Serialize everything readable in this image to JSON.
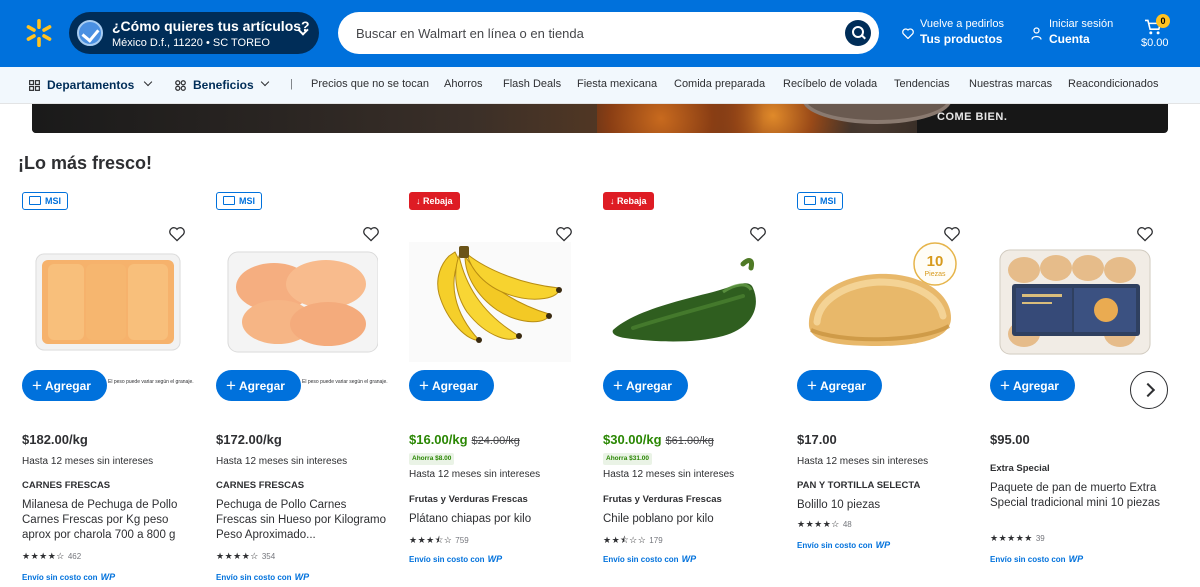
{
  "header": {
    "location_title": "¿Cómo quieres tus artículos?",
    "location_sub": "México D.f., 11220 • SC TOREO",
    "search_placeholder": "Buscar en Walmart en línea o en tienda",
    "reorder_small": "Vuelve a pedirlos",
    "reorder_big": "Tus productos",
    "signin_small": "Iniciar sesión",
    "signin_big": "Cuenta",
    "cart_count": "0",
    "cart_total": "$0.00"
  },
  "nav": {
    "departments": "Departamentos",
    "benefits": "Beneficios",
    "separator": "|",
    "links": [
      "Precios que no se tocan",
      "Ahorros",
      "Flash Deals",
      "Fiesta mexicana",
      "Comida preparada",
      "Recíbelo de volada",
      "Tendencias",
      "Nuestras marcas",
      "Reacondicionados"
    ]
  },
  "banner": {
    "tagline": "COME BIEN."
  },
  "section": {
    "title": "¡Lo más fresco!"
  },
  "products": [
    {
      "badge": "MSI",
      "badge_type": "msi",
      "add_label": "Agregar",
      "fine_print": "El peso puede variar según el granaje.",
      "price": "$182.00/kg",
      "was": "",
      "savings": "",
      "installments": "Hasta 12 meses sin intereses",
      "brand": "CARNES FRESCAS",
      "title": "Milanesa de Pechuga de Pollo Carnes Frescas por Kg peso aprox por charola 700 a 800 g",
      "stars": "★★★★☆",
      "rating_count": "462",
      "shipping": "Envío sin costo con",
      "wp": "WP"
    },
    {
      "badge": "MSI",
      "badge_type": "msi",
      "add_label": "Agregar",
      "fine_print": "El peso puede variar según el granaje.",
      "price": "$172.00/kg",
      "was": "",
      "savings": "",
      "installments": "Hasta 12 meses sin intereses",
      "brand": "CARNES FRESCAS",
      "title": "Pechuga de Pollo Carnes Frescas sin Hueso por Kilogramo Peso Aproximado...",
      "stars": "★★★★☆",
      "rating_count": "354",
      "shipping": "Envío sin costo con",
      "wp": "WP"
    },
    {
      "badge": "Rebaja",
      "badge_type": "sale",
      "add_label": "Agregar",
      "fine_print": "",
      "price": "$16.00/kg",
      "was": "$24.00/kg",
      "savings": "Ahorra $8.00",
      "installments": "Hasta 12 meses sin intereses",
      "brand": "Frutas y Verduras Frescas",
      "title": "Plátano chiapas por kilo",
      "stars": "★★★⯪☆",
      "rating_count": "759",
      "shipping": "Envío sin costo con",
      "wp": "WP"
    },
    {
      "badge": "Rebaja",
      "badge_type": "sale",
      "add_label": "Agregar",
      "fine_print": "",
      "price": "$30.00/kg",
      "was": "$61.00/kg",
      "savings": "Ahorra $31.00",
      "installments": "Hasta 12 meses sin intereses",
      "brand": "Frutas y Verduras Frescas",
      "title": "Chile poblano por kilo",
      "stars": "★★⯪☆☆",
      "rating_count": "179",
      "shipping": "Envío sin costo con",
      "wp": "WP"
    },
    {
      "badge": "MSI",
      "badge_type": "msi",
      "add_label": "Agregar",
      "fine_print": "",
      "price": "$17.00",
      "was": "",
      "savings": "",
      "installments": "Hasta 12 meses sin intereses",
      "brand": "PAN Y TORTILLA SELECTA",
      "title": "Bolillo 10 piezas",
      "stars": "★★★★☆",
      "rating_count": "48",
      "shipping": "Envío sin costo con",
      "wp": "WP",
      "pieces_num": "10",
      "pieces_word": "Piezas"
    },
    {
      "badge": "",
      "badge_type": "none",
      "add_label": "Agregar",
      "fine_print": "",
      "price": "$95.00",
      "was": "",
      "savings": "",
      "installments": "",
      "brand": "Extra Special",
      "title": "Paquete de pan de muerto Extra Special tradicional mini 10 piezas",
      "stars": "★★★★★",
      "rating_count": "39",
      "shipping": "Envío sin costo con",
      "wp": "WP"
    }
  ]
}
